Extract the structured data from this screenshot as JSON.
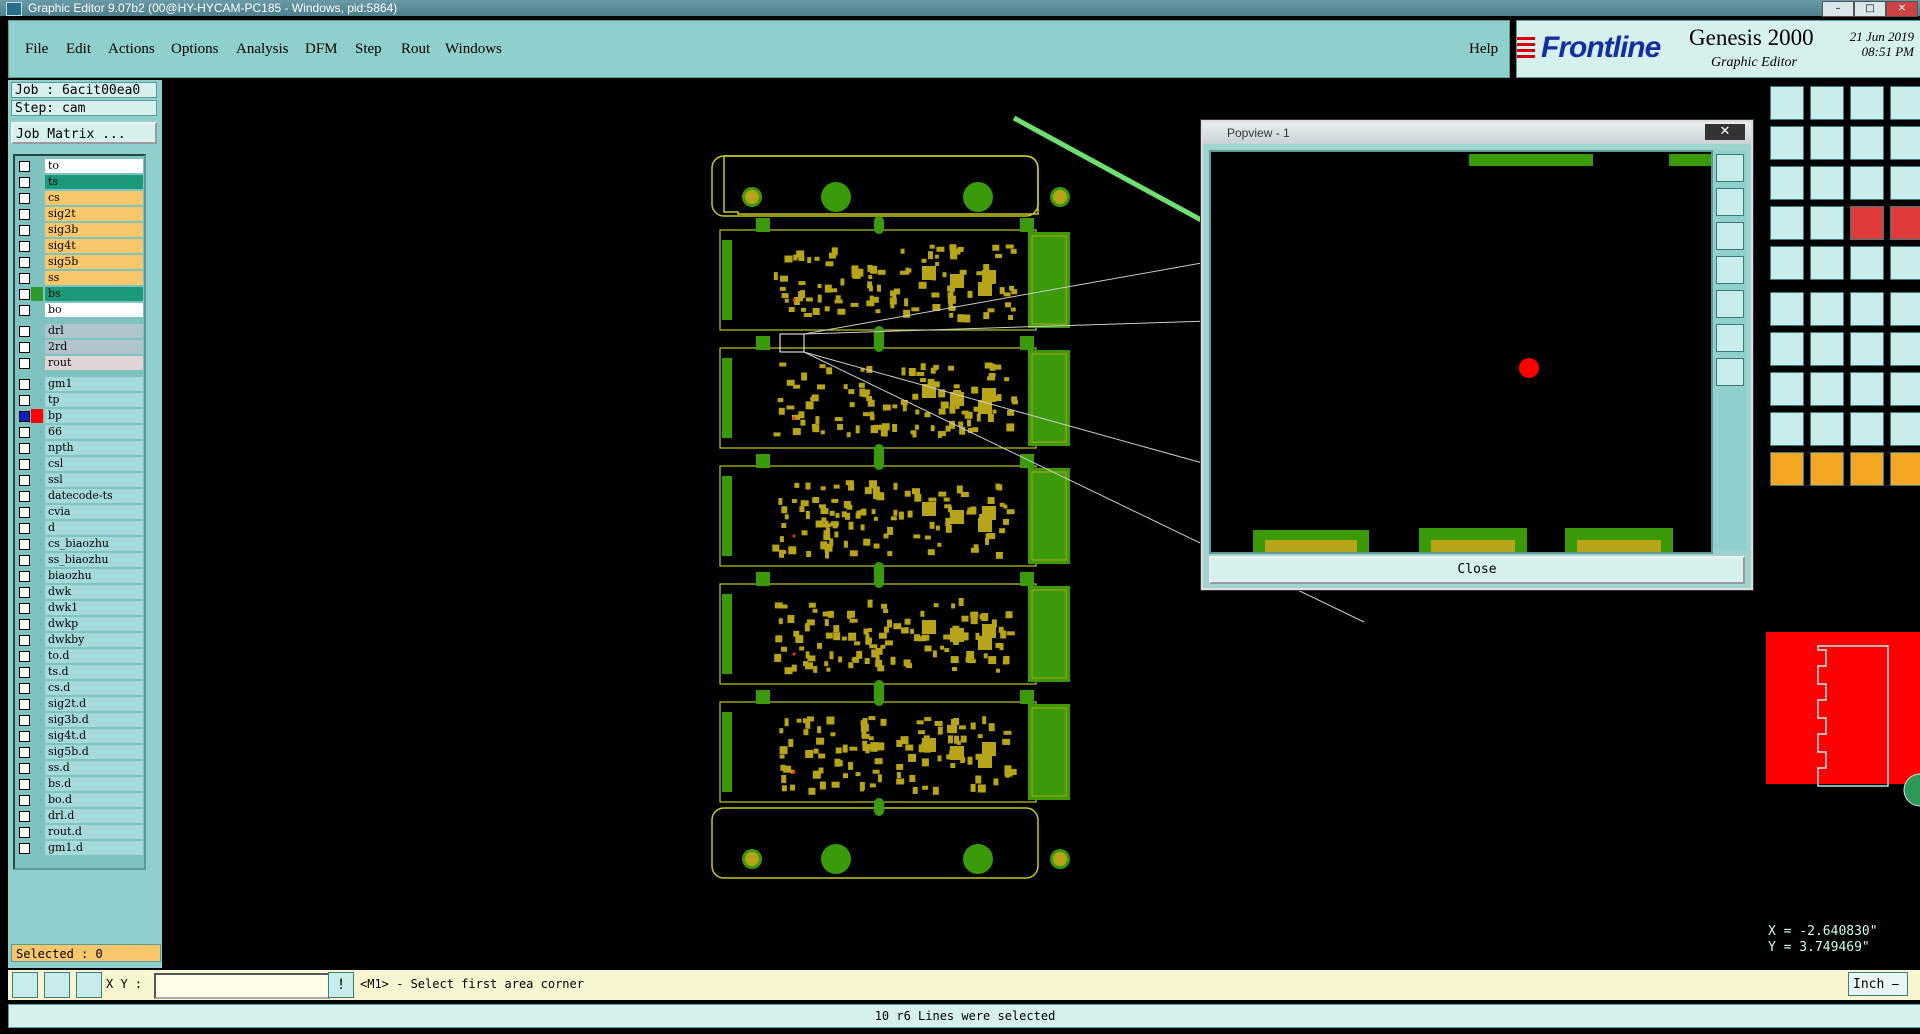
{
  "window": {
    "title": "Graphic Editor 9.07b2 (00@HY-HYCAM-PC185 - Windows, pid:5864)"
  },
  "menu": {
    "items": [
      "File",
      "Edit",
      "Actions",
      "Options",
      "Analysis",
      "DFM",
      "Step",
      "Rout",
      "Windows"
    ],
    "help": "Help"
  },
  "brand": {
    "logo": "Frontline",
    "product": "Genesis 2000",
    "module": "Graphic Editor",
    "date": "21 Jun 2019",
    "time": "08:51 PM"
  },
  "job": {
    "job_label": "Job : 6acit00ea0",
    "step_label": "Step: cam",
    "matrix_button": "Job Matrix ..."
  },
  "layers": [
    {
      "name": "to",
      "color": "#ffffff",
      "sw": ""
    },
    {
      "name": "ts",
      "color": "#1a9a7a",
      "sw": ""
    },
    {
      "name": "cs",
      "color": "#f7c86b",
      "sw": ""
    },
    {
      "name": "sig2t",
      "color": "#f7c86b",
      "sw": ""
    },
    {
      "name": "sig3b",
      "color": "#f7c86b",
      "sw": ""
    },
    {
      "name": "sig4t",
      "color": "#f7c86b",
      "sw": ""
    },
    {
      "name": "sig5b",
      "color": "#f7c86b",
      "sw": ""
    },
    {
      "name": "ss",
      "color": "#f7c86b",
      "sw": ""
    },
    {
      "name": "bs",
      "color": "#1a9a7a",
      "sw": "#2e9a2e"
    },
    {
      "name": "bo",
      "color": "#ffffff",
      "sw": ""
    },
    {
      "name": "drl",
      "color": "#b0c4cc",
      "sw": ""
    },
    {
      "name": "2rd",
      "color": "#b0c4cc",
      "sw": ""
    },
    {
      "name": "rout",
      "color": "#e0d4d4",
      "sw": ""
    },
    {
      "name": "gm1",
      "color": "#a6dada",
      "sw": ""
    },
    {
      "name": "tp",
      "color": "#a6dada",
      "sw": ""
    },
    {
      "name": "bp",
      "color": "#a6dada",
      "sw": "#ff0000"
    },
    {
      "name": "66",
      "color": "#a6dada",
      "sw": ""
    },
    {
      "name": "npth",
      "color": "#a6dada",
      "sw": ""
    },
    {
      "name": "csl",
      "color": "#a6dada",
      "sw": ""
    },
    {
      "name": "ssl",
      "color": "#a6dada",
      "sw": ""
    },
    {
      "name": "datecode-ts",
      "color": "#a6dada",
      "sw": ""
    },
    {
      "name": "cvia",
      "color": "#a6dada",
      "sw": ""
    },
    {
      "name": "d",
      "color": "#a6dada",
      "sw": ""
    },
    {
      "name": "cs_biaozhu",
      "color": "#a6dada",
      "sw": ""
    },
    {
      "name": "ss_biaozhu",
      "color": "#a6dada",
      "sw": ""
    },
    {
      "name": "biaozhu",
      "color": "#a6dada",
      "sw": ""
    },
    {
      "name": "dwk",
      "color": "#a6dada",
      "sw": ""
    },
    {
      "name": "dwk1",
      "color": "#a6dada",
      "sw": ""
    },
    {
      "name": "dwkp",
      "color": "#a6dada",
      "sw": ""
    },
    {
      "name": "dwkby",
      "color": "#a6dada",
      "sw": ""
    },
    {
      "name": "to.d",
      "color": "#a6dada",
      "sw": ""
    },
    {
      "name": "ts.d",
      "color": "#a6dada",
      "sw": ""
    },
    {
      "name": "cs.d",
      "color": "#a6dada",
      "sw": ""
    },
    {
      "name": "sig2t.d",
      "color": "#a6dada",
      "sw": ""
    },
    {
      "name": "sig3b.d",
      "color": "#a6dada",
      "sw": ""
    },
    {
      "name": "sig4t.d",
      "color": "#a6dada",
      "sw": ""
    },
    {
      "name": "sig5b.d",
      "color": "#a6dada",
      "sw": ""
    },
    {
      "name": "ss.d",
      "color": "#a6dada",
      "sw": ""
    },
    {
      "name": "bs.d",
      "color": "#a6dada",
      "sw": ""
    },
    {
      "name": "bo.d",
      "color": "#a6dada",
      "sw": ""
    },
    {
      "name": "drl.d",
      "color": "#a6dada",
      "sw": ""
    },
    {
      "name": "rout.d",
      "color": "#a6dada",
      "sw": ""
    },
    {
      "name": "gm1.d",
      "color": "#a6dada",
      "sw": ""
    }
  ],
  "selected_label": "Selected : 0",
  "popview": {
    "title": "Popview - 1",
    "close_label": "Close"
  },
  "coords": {
    "x": "X = -2.640830\"",
    "y": "Y = 3.749469\""
  },
  "cmd": {
    "xy_label": "X Y :",
    "prompt": "<M1> - Select first area corner",
    "units": "Inch",
    "input_value": ""
  },
  "status": {
    "message": "10 r6 Lines were selected"
  },
  "colors": {
    "board_green": "#3a9a0a",
    "pad_yellow": "#b8a418",
    "outline": "#c8c81e",
    "panel": "#8fcfcc",
    "arrow": "#6de070"
  }
}
